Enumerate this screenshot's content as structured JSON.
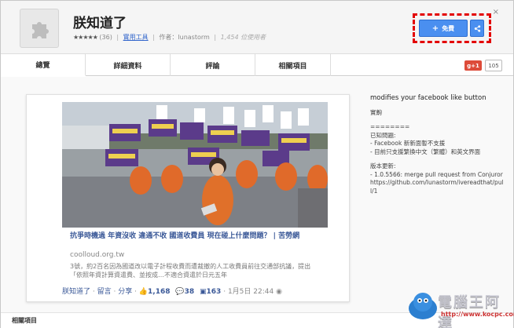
{
  "header": {
    "title": "朕知道了",
    "stars": "★★★★★",
    "rating_count": "(36)",
    "category": "實用工具",
    "author": "作者：lunastorm",
    "users": "1,454 位使用者",
    "close": "×"
  },
  "actions": {
    "free_label": "免費",
    "plus": "+"
  },
  "tabs": [
    {
      "label": "總覽"
    },
    {
      "label": "詳細資料"
    },
    {
      "label": "評論"
    },
    {
      "label": "相關項目"
    }
  ],
  "gplus": {
    "label": "g+1",
    "count": "105"
  },
  "preview": {
    "link_title": "抗爭時機過 年資沒收 違通不收 國道收費員 現在碰上什麼問題？ | 苦勞網",
    "domain": "coolloud.org.tw",
    "description": "3號，約2百名因為國道改以電子計程收費而遭裁撤的人工收費員前往交通部抗議，提出「依照年資計算資遣費、並按成…不適合資遣於日元五年",
    "fb_name": "朕知道了",
    "fb_comment": "留言",
    "fb_share": "分享",
    "likes": "1,168",
    "comments": "38",
    "shares": "163",
    "time": "1月5日 22:44"
  },
  "description_panel": {
    "headline": "modifies your facebook like button",
    "line1": "實齁",
    "divider": "========",
    "known_title": "已知問題:",
    "known1": "- Facebook 新新面暫不支援",
    "known2": "- 目前只支援繁換中文（繁體）和英文界面",
    "version_title": "版本更新:",
    "version1": "- 1.0.5566: merge pull request from Conjuror",
    "version2": "https://github.com/lunastorm/iveread​that/pull/1"
  },
  "related": {
    "label": "相關項目"
  },
  "watermark": {
    "text": "電腦王阿達",
    "url": "http://www.kocpc.com.tw"
  },
  "colors": {
    "accent": "#4a8ff0",
    "dashed": "#e30000",
    "fb": "#3b5998",
    "gplus": "#dd4b39"
  }
}
